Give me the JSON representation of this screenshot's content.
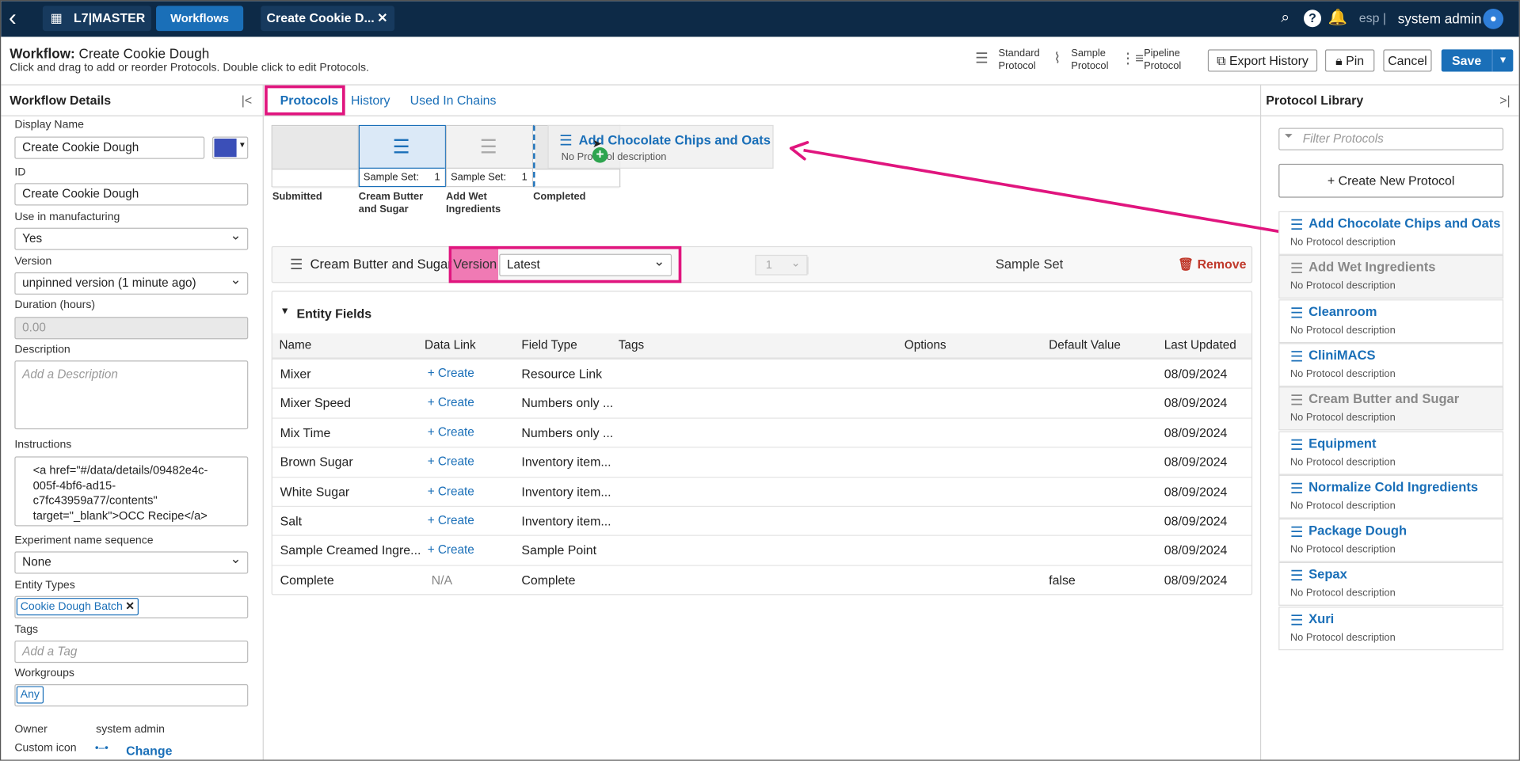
{
  "topbar": {
    "app_name": "L7|MASTER",
    "workflows_label": "Workflows",
    "open_tab": "Create Cookie D...",
    "lang": "esp |",
    "user": "system admin"
  },
  "header": {
    "label": "Workflow:",
    "name": "Create Cookie Dough",
    "subtitle": "Click and drag to add or reorder Protocols. Double click to edit Protocols.",
    "types": [
      {
        "l1": "Standard",
        "l2": "Protocol"
      },
      {
        "l1": "Sample",
        "l2": "Protocol"
      },
      {
        "l1": "Pipeline",
        "l2": "Protocol"
      }
    ],
    "export": "Export History",
    "pin": "Pin",
    "cancel": "Cancel",
    "save": "Save"
  },
  "left": {
    "title": "Workflow Details",
    "display_name_label": "Display Name",
    "display_name": "Create Cookie Dough",
    "color": "#3b4fb8",
    "id_label": "ID",
    "id": "Create Cookie Dough",
    "manufacturing_label": "Use in manufacturing",
    "manufacturing": "Yes",
    "version_label": "Version",
    "version": "unpinned version (1 minute ago)",
    "duration_label": "Duration (hours)",
    "duration": "0.00",
    "description_label": "Description",
    "description_ph": "Add a Description",
    "instructions_label": "Instructions",
    "instructions_l1": "<a href=\"#/data/details/09482e4c-",
    "instructions_l2": "005f-4bf6-ad15-",
    "instructions_l3": "c7fc43959a77/contents\"",
    "instructions_l4": "target=\"_blank\">OCC Recipe</a>",
    "exp_seq_label": "Experiment name sequence",
    "exp_seq": "None",
    "entity_types_label": "Entity Types",
    "entity_type": "Cookie Dough Batch",
    "tags_label": "Tags",
    "tags_ph": "Add a Tag",
    "workgroups_label": "Workgroups",
    "workgroup": "Any",
    "owner_label": "Owner",
    "owner": "system admin",
    "icon_label": "Custom icon",
    "change": "Change"
  },
  "tabs": [
    "Protocols",
    "History",
    "Used In Chains"
  ],
  "diagram": {
    "steps": [
      {
        "label1": "Submitted",
        "label2": ""
      },
      {
        "label1": "Cream Butter",
        "label2": "and Sugar",
        "set": "Sample Set:",
        "n": "1"
      },
      {
        "label1": "Add Wet",
        "label2": "Ingredients",
        "set": "Sample Set:",
        "n": "1"
      },
      {
        "label1": "Completed",
        "label2": ""
      }
    ],
    "drag_name": "Add Chocolate Chips and Oats",
    "drag_desc": "No Protocol description"
  },
  "protocol_bar": {
    "name": "Cream Butter and Sugar",
    "version_label": "Version",
    "version": "Latest",
    "sample_set_label": "Sample Set",
    "sample_set": "1",
    "remove": "Remove"
  },
  "entity": {
    "title": "Entity Fields",
    "headers": [
      "Name",
      "Data Link",
      "Field Type",
      "Tags",
      "Options",
      "Default Value",
      "Last Updated"
    ],
    "rows": [
      {
        "name": "Mixer",
        "link": "Create",
        "type": "Resource Link",
        "default": "",
        "updated": "08/09/2024"
      },
      {
        "name": "Mixer Speed",
        "link": "Create",
        "type": "Numbers only ...",
        "default": "",
        "updated": "08/09/2024"
      },
      {
        "name": "Mix Time",
        "link": "Create",
        "type": "Numbers only ...",
        "default": "",
        "updated": "08/09/2024"
      },
      {
        "name": "Brown Sugar",
        "link": "Create",
        "type": "Inventory item...",
        "default": "",
        "updated": "08/09/2024"
      },
      {
        "name": "White Sugar",
        "link": "Create",
        "type": "Inventory item...",
        "default": "",
        "updated": "08/09/2024"
      },
      {
        "name": "Salt",
        "link": "Create",
        "type": "Inventory item...",
        "default": "",
        "updated": "08/09/2024"
      },
      {
        "name": "Sample Creamed Ingre...",
        "link": "Create",
        "type": "Sample Point",
        "default": "",
        "updated": "08/09/2024"
      },
      {
        "name": "Complete",
        "link": "N/A",
        "type": "Complete",
        "default": "false",
        "updated": "08/09/2024"
      }
    ]
  },
  "library": {
    "title": "Protocol Library",
    "filter_ph": "Filter Protocols",
    "create": "Create New Protocol",
    "items": [
      {
        "name": "Add Chocolate Chips and Oats",
        "desc": "No Protocol description"
      },
      {
        "name": "Add Wet Ingredients",
        "desc": "No Protocol description"
      },
      {
        "name": "Cleanroom",
        "desc": "No Protocol description"
      },
      {
        "name": "CliniMACS",
        "desc": "No Protocol description"
      },
      {
        "name": "Cream Butter and Sugar",
        "desc": "No Protocol description"
      },
      {
        "name": "Equipment",
        "desc": "No Protocol description"
      },
      {
        "name": "Normalize Cold Ingredients",
        "desc": "No Protocol description"
      },
      {
        "name": "Package Dough",
        "desc": "No Protocol description"
      },
      {
        "name": "Sepax",
        "desc": "No Protocol description"
      },
      {
        "name": "Xuri",
        "desc": "No Protocol description"
      }
    ]
  },
  "colors": {
    "accent": "#1a6fb8",
    "highlight": "#e0157e",
    "navbar": "#0d2a47"
  }
}
